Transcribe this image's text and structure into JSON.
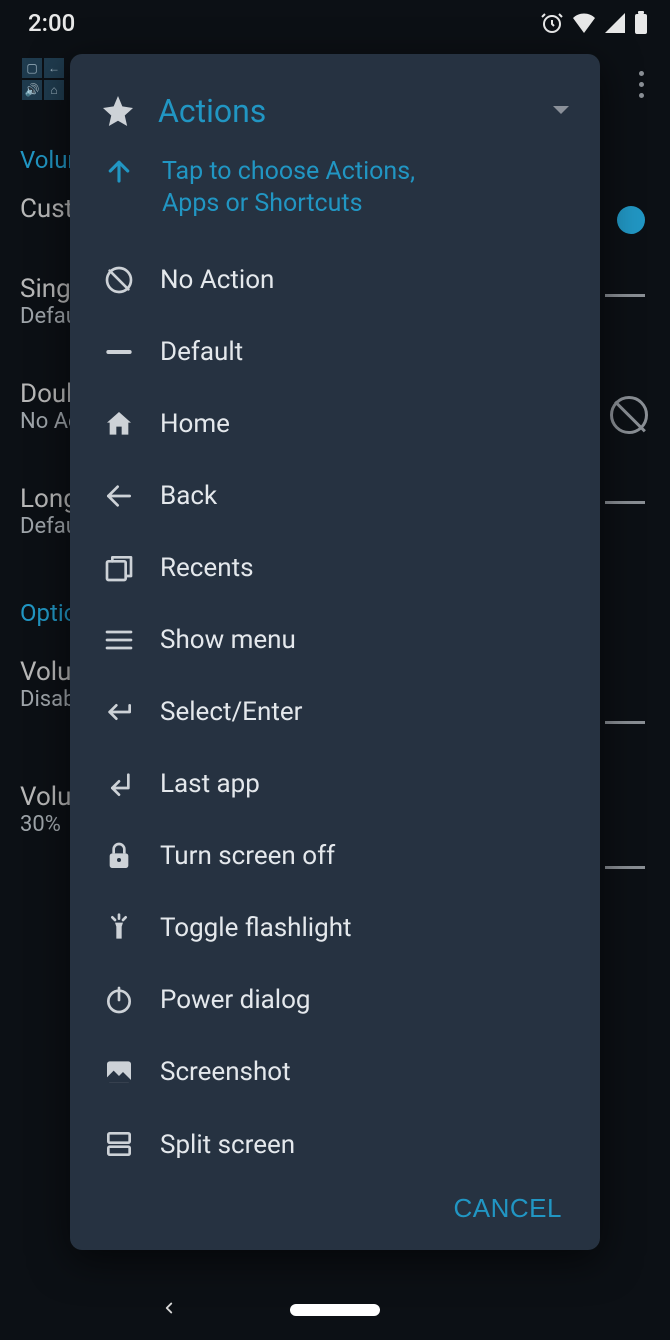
{
  "status": {
    "time": "2:00"
  },
  "background": {
    "section1": "Volume",
    "row1": "Custom",
    "row2": "Single",
    "row2sub": "Default",
    "row3": "Double",
    "row3sub": "No Action",
    "row4": "Long",
    "row4sub": "Default",
    "section2": "Options",
    "row5": "Volume",
    "row5sub": "Disabled",
    "row6": "Volume",
    "row6sub": "30%"
  },
  "dialog": {
    "title": "Actions",
    "hint": "Tap to choose Actions, Apps or Shortcuts",
    "cancel": "CANCEL",
    "items": [
      {
        "id": "no-action",
        "label": "No Action",
        "icon": "no-sign"
      },
      {
        "id": "default",
        "label": "Default",
        "icon": "dash"
      },
      {
        "id": "home",
        "label": "Home",
        "icon": "home"
      },
      {
        "id": "back",
        "label": "Back",
        "icon": "arrow-left"
      },
      {
        "id": "recents",
        "label": "Recents",
        "icon": "recents"
      },
      {
        "id": "show-menu",
        "label": "Show menu",
        "icon": "menu"
      },
      {
        "id": "select-enter",
        "label": "Select/Enter",
        "icon": "return"
      },
      {
        "id": "last-app",
        "label": "Last app",
        "icon": "last-app"
      },
      {
        "id": "screen-off",
        "label": "Turn screen off",
        "icon": "lock"
      },
      {
        "id": "flashlight",
        "label": "Toggle flashlight",
        "icon": "flashlight"
      },
      {
        "id": "power-dialog",
        "label": "Power dialog",
        "icon": "power"
      },
      {
        "id": "screenshot",
        "label": "Screenshot",
        "icon": "image"
      },
      {
        "id": "split-screen",
        "label": "Split screen",
        "icon": "split"
      }
    ]
  }
}
